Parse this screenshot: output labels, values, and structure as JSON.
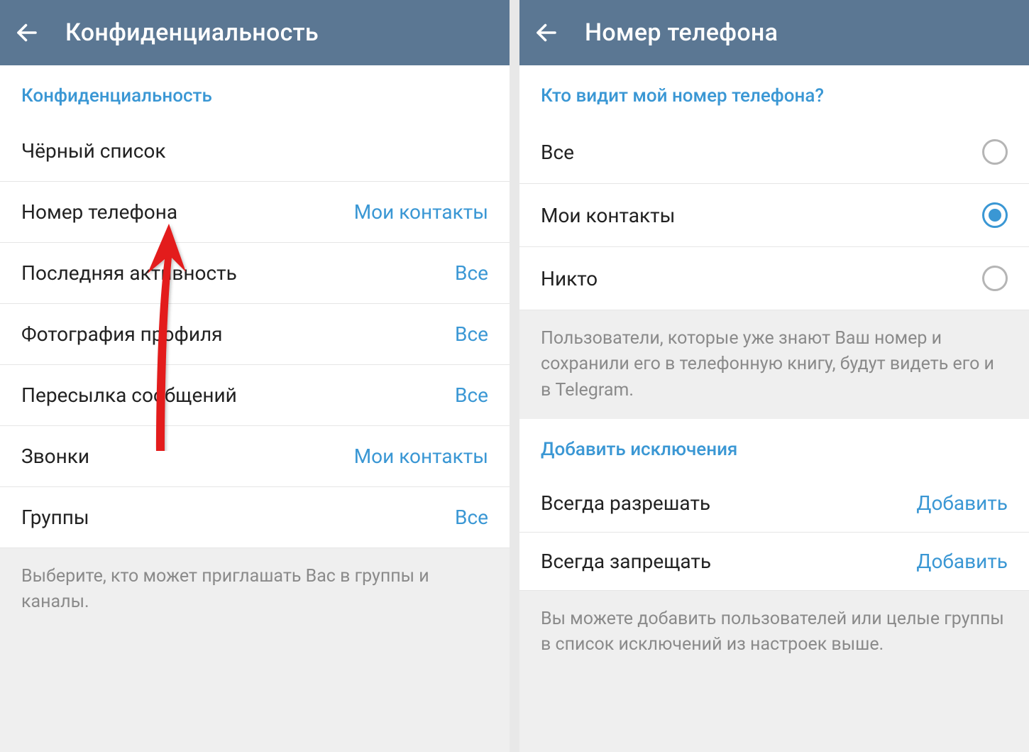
{
  "left": {
    "title": "Конфиденциальность",
    "section": "Конфиденциальность",
    "items": [
      {
        "label": "Чёрный список",
        "value": ""
      },
      {
        "label": "Номер телефона",
        "value": "Мои контакты"
      },
      {
        "label": "Последняя активность",
        "value": "Все"
      },
      {
        "label": "Фотография профиля",
        "value": "Все"
      },
      {
        "label": "Пересылка сообщений",
        "value": "Все"
      },
      {
        "label": "Звонки",
        "value": "Мои контакты"
      },
      {
        "label": "Группы",
        "value": "Все"
      }
    ],
    "footer": "Выберите, кто может приглашать Вас в группы и каналы."
  },
  "right": {
    "title": "Номер телефона",
    "section_who": "Кто видит мой номер телефона?",
    "options": [
      {
        "label": "Все",
        "selected": false
      },
      {
        "label": "Мои контакты",
        "selected": true
      },
      {
        "label": "Никто",
        "selected": false
      }
    ],
    "info": "Пользователи, которые уже знают Ваш номер и сохранили его в телефонную книгу, будут видеть его и в Telegram.",
    "section_exceptions": "Добавить исключения",
    "exceptions": [
      {
        "label": "Всегда разрешать",
        "action": "Добавить"
      },
      {
        "label": "Всегда запрещать",
        "action": "Добавить"
      }
    ],
    "footer": "Вы можете добавить пользователей или целые группы в список исключений из настроек выше."
  }
}
